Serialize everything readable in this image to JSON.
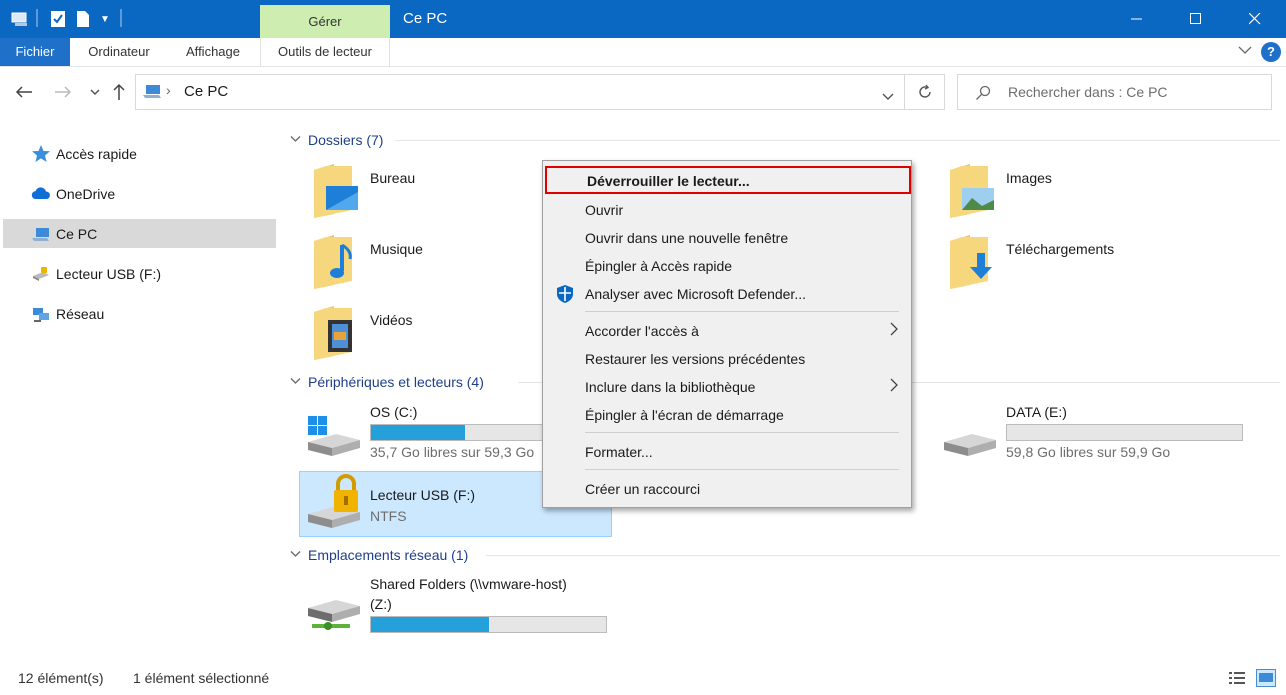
{
  "window": {
    "title": "Ce PC",
    "context_tab_header": "Gérer"
  },
  "ribbon": {
    "tabs": [
      "Fichier",
      "Ordinateur",
      "Affichage",
      "Outils de lecteur"
    ]
  },
  "address": {
    "path": "Ce PC",
    "search_placeholder": "Rechercher dans : Ce PC"
  },
  "sidebar": {
    "items": [
      {
        "label": "Accès rapide",
        "icon": "star-icon"
      },
      {
        "label": "OneDrive",
        "icon": "cloud-icon"
      },
      {
        "label": "Ce PC",
        "icon": "computer-icon",
        "selected": true
      },
      {
        "label": "Lecteur USB (F:)",
        "icon": "usb-drive-icon"
      },
      {
        "label": "Réseau",
        "icon": "network-icon"
      }
    ]
  },
  "groups": {
    "folders": "Dossiers (7)",
    "devices": "Périphériques et lecteurs (4)",
    "network": "Emplacements réseau (1)"
  },
  "folders": [
    {
      "name": "Bureau",
      "icon": "desktop-folder-icon"
    },
    {
      "name": "Images",
      "icon": "pictures-folder-icon"
    },
    {
      "name": "Musique",
      "icon": "music-folder-icon"
    },
    {
      "name": "Téléchargements",
      "icon": "downloads-folder-icon"
    },
    {
      "name": "Vidéos",
      "icon": "videos-folder-icon"
    }
  ],
  "drives": [
    {
      "name": "OS (C:)",
      "sub": "35,7 Go libres sur 59,3 Go",
      "used_fraction": 0.4
    },
    {
      "name": "DATA (E:)",
      "sub": "59,8 Go libres sur 59,9 Go",
      "used_fraction": 0.0
    },
    {
      "name": "Lecteur USB (F:)",
      "sub": "NTFS",
      "locked": true
    }
  ],
  "network_locations": [
    {
      "name": "Shared Folders (\\\\vmware-host)",
      "name2": "(Z:)",
      "used_fraction": 0.5
    }
  ],
  "context_menu": {
    "items": [
      {
        "label": "Déverrouiller le lecteur...",
        "highlighted": true
      },
      {
        "label": "Ouvrir"
      },
      {
        "label": "Ouvrir dans une nouvelle fenêtre"
      },
      {
        "label": "Épingler à Accès rapide"
      },
      {
        "label": "Analyser avec Microsoft Defender...",
        "icon": "defender-shield-icon"
      },
      {
        "label": "Accorder l'accès à",
        "submenu": true
      },
      {
        "label": "Restaurer les versions précédentes"
      },
      {
        "label": "Inclure dans la bibliothèque",
        "submenu": true
      },
      {
        "label": "Épingler à l'écran de démarrage"
      },
      {
        "label": "Formater..."
      },
      {
        "label": "Créer un raccourci"
      }
    ]
  },
  "statusbar": {
    "count": "12 élément(s)",
    "selection": "1 élément sélectionné"
  },
  "colors": {
    "titlebar": "#0a67c2",
    "context_tab": "#cdeeb0",
    "bar_fill": "#26a0da",
    "highlight_border": "#e00000"
  }
}
